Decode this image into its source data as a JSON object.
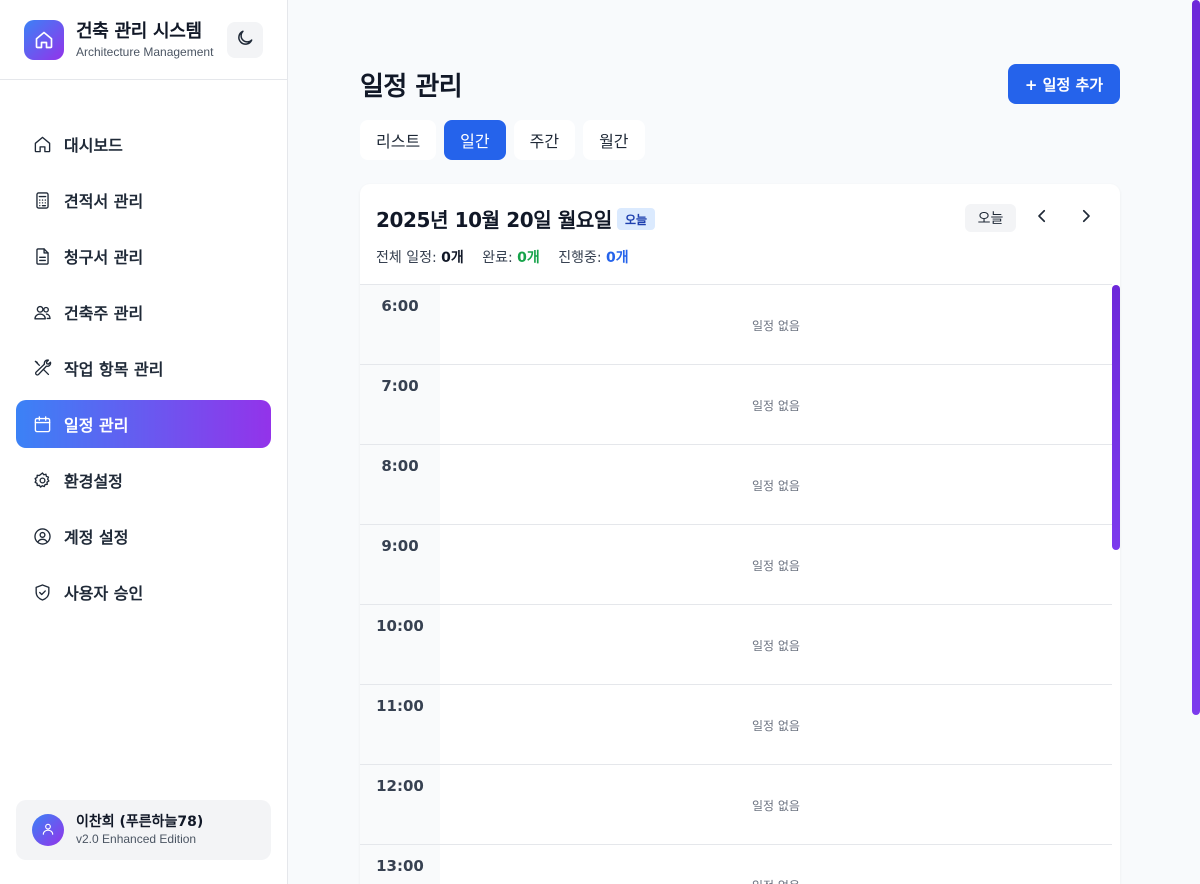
{
  "brand": {
    "title": "건축 관리 시스템",
    "subtitle": "Architecture Management",
    "logo_icon": "home-icon",
    "theme_icon": "moon-icon"
  },
  "sidebar": {
    "items": [
      {
        "label": "대시보드",
        "icon": "home-icon",
        "active": false
      },
      {
        "label": "견적서 관리",
        "icon": "calculator-icon",
        "active": false
      },
      {
        "label": "청구서 관리",
        "icon": "file-text-icon",
        "active": false
      },
      {
        "label": "건축주 관리",
        "icon": "users-icon",
        "active": false
      },
      {
        "label": "작업 항목 관리",
        "icon": "tools-icon",
        "active": false
      },
      {
        "label": "일정 관리",
        "icon": "calendar-icon",
        "active": true
      },
      {
        "label": "환경설정",
        "icon": "gear-icon",
        "active": false
      },
      {
        "label": "계정 설정",
        "icon": "user-circle-icon",
        "active": false
      },
      {
        "label": "사용자 승인",
        "icon": "shield-check-icon",
        "active": false
      }
    ]
  },
  "user": {
    "name": "이찬희 (푸른하늘78)",
    "version": "v2.0 Enhanced Edition"
  },
  "header": {
    "title": "일정 관리",
    "add_button": "+ 일정 추가"
  },
  "tabs": [
    {
      "label": "리스트",
      "active": false
    },
    {
      "label": "일간",
      "active": true
    },
    {
      "label": "주간",
      "active": false
    },
    {
      "label": "월간",
      "active": false
    }
  ],
  "day": {
    "date": "2025년 10월 20일 월요일",
    "today_badge": "오늘",
    "today_button": "오늘",
    "stats": {
      "total_label": "전체 일정:",
      "total_value": "0개",
      "done_label": "완료:",
      "done_value": "0개",
      "progress_label": "진행중:",
      "progress_value": "0개"
    },
    "slots": [
      {
        "time": "6:00",
        "text": "일정 없음"
      },
      {
        "time": "7:00",
        "text": "일정 없음"
      },
      {
        "time": "8:00",
        "text": "일정 없음"
      },
      {
        "time": "9:00",
        "text": "일정 없음"
      },
      {
        "time": "10:00",
        "text": "일정 없음"
      },
      {
        "time": "11:00",
        "text": "일정 없음"
      },
      {
        "time": "12:00",
        "text": "일정 없음"
      },
      {
        "time": "13:00",
        "text": "일정 없음"
      }
    ]
  },
  "colors": {
    "accent": "#2563eb",
    "gradient_start": "#3b82f6",
    "gradient_end": "#9333ea",
    "done": "#16a34a"
  }
}
